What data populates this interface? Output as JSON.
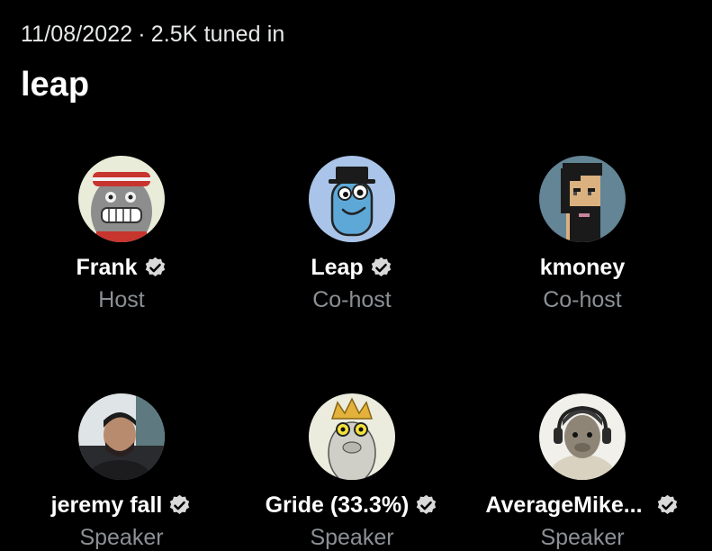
{
  "space": {
    "date": "11/08/2022",
    "separator": "·",
    "listeners": "2.5K tuned in",
    "title": "leap"
  },
  "participants": [
    {
      "name": "Frank",
      "role": "Host",
      "verified": true,
      "avatar": "bored-ape-avatar"
    },
    {
      "name": "Leap",
      "role": "Co-host",
      "verified": true,
      "avatar": "blue-cartoon-avatar"
    },
    {
      "name": "kmoney",
      "role": "Co-host",
      "verified": false,
      "avatar": "cryptopunk-avatar"
    },
    {
      "name": "jeremy fall",
      "role": "Speaker",
      "verified": true,
      "avatar": "photo-avatar"
    },
    {
      "name": "Gride (33.3%)",
      "role": "Speaker",
      "verified": true,
      "avatar": "crowned-ape-avatar"
    },
    {
      "name": "AverageMike...",
      "role": "Speaker",
      "verified": true,
      "avatar": "headphones-ape-avatar"
    }
  ],
  "colors": {
    "background": "#000000",
    "text": "#e7e9ea",
    "secondary": "#8b9095",
    "verified_badge": "#d9d9d9"
  }
}
